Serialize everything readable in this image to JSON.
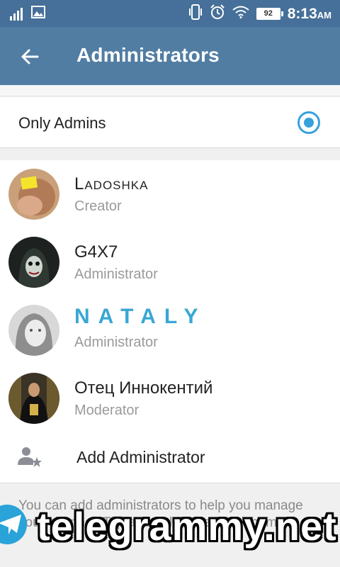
{
  "status_bar": {
    "time": "8:13",
    "ampm": "AM",
    "battery": "92",
    "icons": [
      "signal-icon",
      "image-icon",
      "vibrate-icon",
      "alarm-icon",
      "wifi-icon",
      "battery-icon"
    ]
  },
  "header": {
    "title": "Administrators",
    "back_icon": "arrow-left-icon",
    "background": "#527da3"
  },
  "option": {
    "label": "Only Admins",
    "selected": true,
    "accent": "#37a1de"
  },
  "admins": [
    {
      "name": "Ladoshka",
      "role": "Creator"
    },
    {
      "name": "G4X7",
      "role": "Administrator"
    },
    {
      "name": "NATALY",
      "role": "Administrator"
    },
    {
      "name": "Отец Иннокентий",
      "role": "Moderator"
    }
  ],
  "add_admin": {
    "label": "Add Administrator",
    "icon": "person-star-icon"
  },
  "hint": "You can add administrators to help you manage your channel. Tap and hold to remove them.",
  "watermark": "telegrammy.net"
}
